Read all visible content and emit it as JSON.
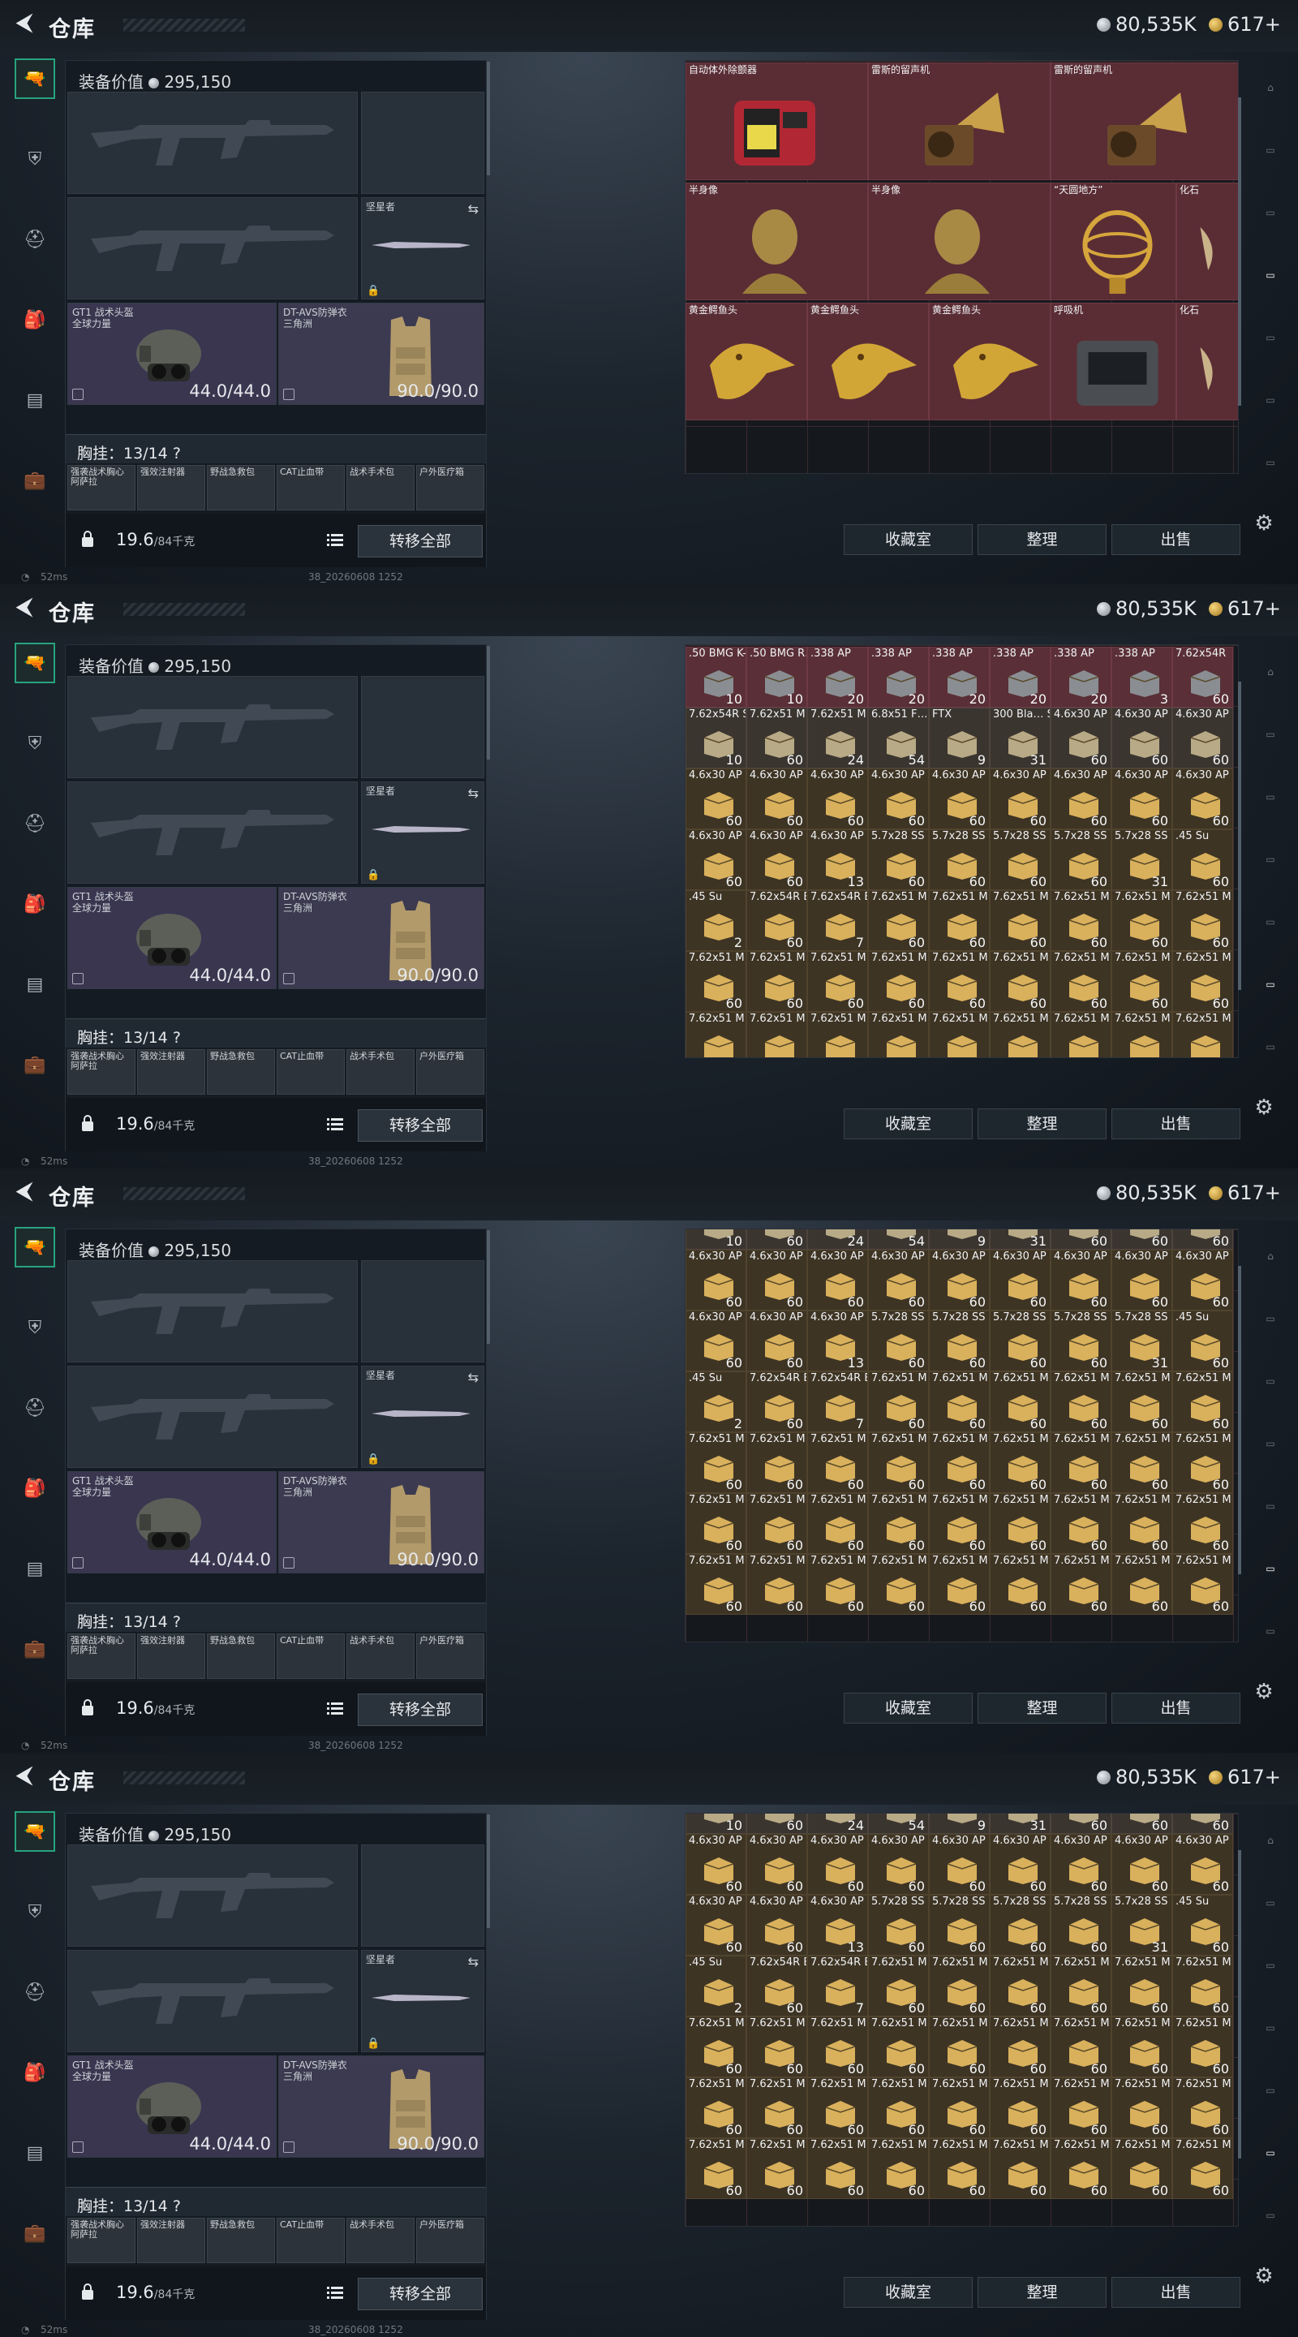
{
  "topbar": {
    "title": "仓库",
    "silver": "80,535K",
    "gold": "617+"
  },
  "equipment": {
    "value_label": "装备价值",
    "value": "295,150",
    "melee_label": "坚星者",
    "helmet": {
      "label": "GT1 战术头盔",
      "sub": "全球力量",
      "durability": "44.0/44.0"
    },
    "vest": {
      "label": "DT-AVS防弹衣",
      "sub": "三角洲",
      "durability": "90.0/90.0"
    },
    "rig_label": "胸挂：13/14",
    "rig_help": "?",
    "rig_items": [
      "强袭战术胸心 阿萨拉",
      "强效注射器",
      "野战急救包",
      "CAT止血带",
      "战术手术包",
      "户外医疗箱"
    ],
    "weight": "19.6",
    "weight_unit": "/84千克",
    "transfer_all": "转移全部"
  },
  "status": {
    "ping": "52ms",
    "build": "38_20260608 1252"
  },
  "actions": {
    "collect": "收藏室",
    "sort": "整理",
    "sell": "出售"
  },
  "treasures": {
    "rows": [
      [
        {
          "name": "",
          "kind": "top"
        },
        {
          "name": "",
          "kind": "top"
        },
        {
          "name": "",
          "kind": "top"
        }
      ],
      [
        {
          "name": "自动体外除颤器",
          "kind": "aed"
        },
        {
          "name": "雷斯的留声机",
          "kind": "phono"
        },
        {
          "name": "雷斯的留声机",
          "kind": "phono"
        }
      ],
      [
        {
          "name": "半身像",
          "kind": "bust"
        },
        {
          "name": "半身像",
          "kind": "bust"
        },
        {
          "name": "“天圆地方”",
          "kind": "globe"
        },
        {
          "name": "化石",
          "kind": "fossil"
        }
      ],
      [
        {
          "name": "黄金鳄鱼头",
          "kind": "croc"
        },
        {
          "name": "黄金鳄鱼头",
          "kind": "croc"
        },
        {
          "name": "黄金鳄鱼头",
          "kind": "croc"
        },
        {
          "name": "呼吸机",
          "kind": "vent"
        },
        {
          "name": "化石",
          "kind": "fossil"
        }
      ]
    ]
  },
  "ammo": {
    "row1": [
      {
        "n": ".50 BMG K-…",
        "c": "10",
        "s": "red"
      },
      {
        "n": ".50 BMG R…",
        "c": "10",
        "s": "red"
      },
      {
        "n": ".338 AP",
        "c": "20",
        "s": "red"
      },
      {
        "n": ".338 AP",
        "c": "20",
        "s": "red"
      },
      {
        "n": ".338 AP",
        "c": "20",
        "s": "red"
      },
      {
        "n": ".338 AP",
        "c": "20",
        "s": "red"
      },
      {
        "n": ".338 AP",
        "c": "20",
        "s": "red"
      },
      {
        "n": ".338 AP",
        "c": "3",
        "s": "red"
      },
      {
        "n": "7.62x54R",
        "c": "60",
        "s": "red"
      }
    ],
    "row2": [
      {
        "n": "7.62x54R S…",
        "c": "10",
        "s": "dark"
      },
      {
        "n": "7.62x51 M…",
        "c": "60",
        "s": "dark"
      },
      {
        "n": "7.62x51 M…",
        "c": "24",
        "s": "dark"
      },
      {
        "n": "6.8x51 F…",
        "c": "54",
        "s": "dark"
      },
      {
        "n": "FTX",
        "c": "9",
        "s": "dark"
      },
      {
        "n": "300 Bla… SUB",
        "c": "31",
        "s": "dark"
      },
      {
        "n": "4.6x30 AP",
        "c": "60",
        "s": "dark"
      },
      {
        "n": "4.6x30 AP",
        "c": "60",
        "s": "dark"
      },
      {
        "n": "4.6x30 AP",
        "c": "60",
        "s": "dark"
      }
    ],
    "row_a": [
      {
        "n": "4.6x30 AP",
        "c": "60"
      },
      {
        "n": "4.6x30 AP",
        "c": "60"
      },
      {
        "n": "4.6x30 AP",
        "c": "60"
      },
      {
        "n": "4.6x30 AP",
        "c": "60"
      },
      {
        "n": "4.6x30 AP",
        "c": "60"
      },
      {
        "n": "4.6x30 AP",
        "c": "60"
      },
      {
        "n": "4.6x30 AP",
        "c": "60"
      },
      {
        "n": "4.6x30 AP",
        "c": "60"
      },
      {
        "n": "4.6x30 AP",
        "c": "60"
      }
    ],
    "row_b": [
      {
        "n": "4.6x30 AP",
        "c": "60"
      },
      {
        "n": "4.6x30 AP",
        "c": "60"
      },
      {
        "n": "4.6x30 AP",
        "c": "13"
      },
      {
        "n": "5.7x28 SS",
        "c": "60"
      },
      {
        "n": "5.7x28 SS",
        "c": "60"
      },
      {
        "n": "5.7x28 SS",
        "c": "60"
      },
      {
        "n": "5.7x28 SS",
        "c": "60"
      },
      {
        "n": "5.7x28 SS",
        "c": "31"
      },
      {
        "n": ".45 Su",
        "c": "60"
      }
    ],
    "row_c": [
      {
        "n": ".45 Su",
        "c": "2"
      },
      {
        "n": "7.62x54R B",
        "c": "60"
      },
      {
        "n": "7.62x54R B",
        "c": "7"
      },
      {
        "n": "7.62x51 M",
        "c": "60"
      },
      {
        "n": "7.62x51 M",
        "c": "60"
      },
      {
        "n": "7.62x51 M",
        "c": "60"
      },
      {
        "n": "7.62x51 M",
        "c": "60"
      },
      {
        "n": "7.62x51 M",
        "c": "60"
      },
      {
        "n": "7.62x51 M",
        "c": "60"
      }
    ],
    "row_d": [
      {
        "n": "7.62x51 M",
        "c": "60"
      },
      {
        "n": "7.62x51 M",
        "c": "60"
      },
      {
        "n": "7.62x51 M",
        "c": "60"
      },
      {
        "n": "7.62x51 M",
        "c": "60"
      },
      {
        "n": "7.62x51 M",
        "c": "60"
      },
      {
        "n": "7.62x51 M",
        "c": "60"
      },
      {
        "n": "7.62x51 M",
        "c": "60"
      },
      {
        "n": "7.62x51 M",
        "c": "60"
      },
      {
        "n": "7.62x51 M",
        "c": "60"
      }
    ]
  },
  "colors": {
    "accent": "#27a37f",
    "treasure_bg": "#5a2d35"
  }
}
